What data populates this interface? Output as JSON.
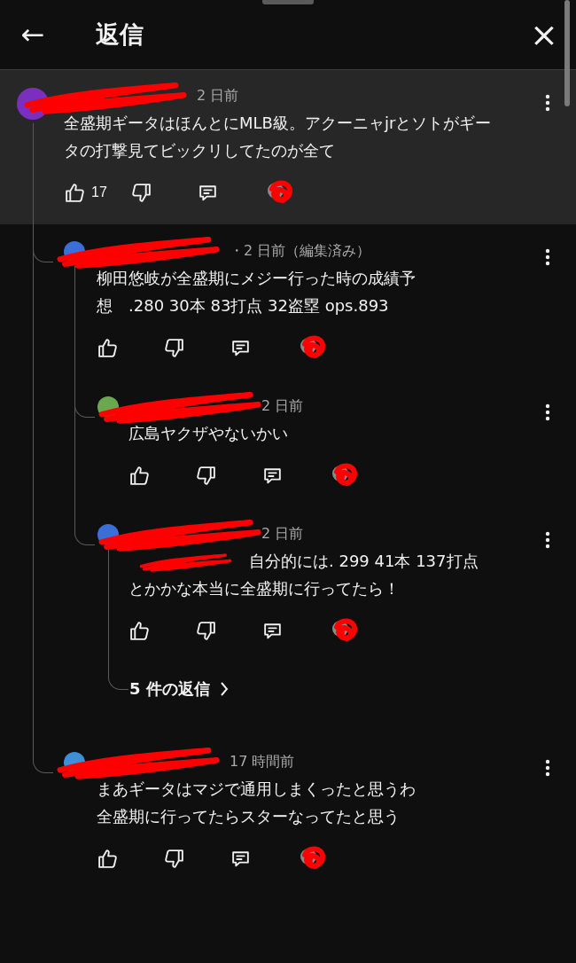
{
  "header": {
    "back": "←",
    "title": "返信",
    "close": "×"
  },
  "comment": {
    "meta": "2 日前",
    "highlighted": true,
    "body": "全盛期ギータはほんとにMLB級。アクーニャjrとソトがギータの打撃見てビックリしてたのが全て",
    "likes": "17",
    "children": [
      {
        "meta": "・2 日前（編集済み）",
        "highlighted": false,
        "body": "柳田悠岐が全盛期にメジー行った時の成績予想　.280 30本 83打点 32盗塁 ops.893",
        "children": [
          {
            "meta": "2 日前",
            "highlighted": false,
            "body": "広島ヤクザやないかい"
          },
          {
            "meta": "2 日前",
            "highlighted": false,
            "mention_redacted": true,
            "body": "自分的には. 299 41本 137打点とかかな本当に全盛期に行ってたら！",
            "more_replies": "5 件の返信"
          }
        ]
      },
      {
        "meta": "17 時間前",
        "highlighted": false,
        "body": "まあギータはマジで通用しまくったと思うわ",
        "body_2": "全盛期に行ってたらスターなってたと思う"
      }
    ]
  }
}
